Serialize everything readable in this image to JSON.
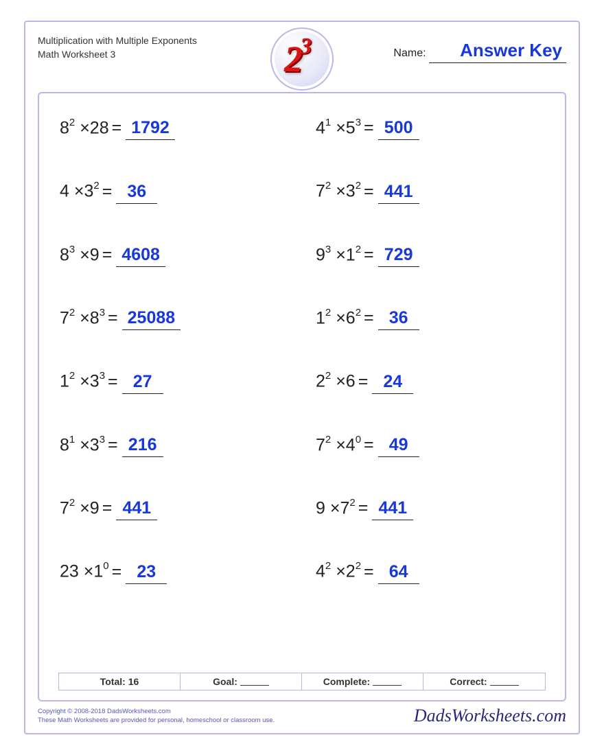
{
  "header": {
    "title_line1": "Multiplication with Multiple Exponents",
    "title_line2": "Math Worksheet 3",
    "name_label": "Name:",
    "name_value": "Answer Key",
    "logo_base": "2",
    "logo_exp": "3"
  },
  "problems": [
    {
      "b1": "8",
      "e1": "2",
      "op": "×",
      "b2": "28",
      "e2": "",
      "answer": "1792"
    },
    {
      "b1": "4",
      "e1": "1",
      "op": "×",
      "b2": "5",
      "e2": "3",
      "answer": "500"
    },
    {
      "b1": "4",
      "e1": "",
      "op": "×",
      "b2": "3",
      "e2": "2",
      "answer": "36"
    },
    {
      "b1": "7",
      "e1": "2",
      "op": "×",
      "b2": "3",
      "e2": "2",
      "answer": "441"
    },
    {
      "b1": "8",
      "e1": "3",
      "op": "×",
      "b2": "9",
      "e2": "",
      "answer": "4608"
    },
    {
      "b1": "9",
      "e1": "3",
      "op": "×",
      "b2": "1",
      "e2": "2",
      "answer": "729"
    },
    {
      "b1": "7",
      "e1": "2",
      "op": "×",
      "b2": "8",
      "e2": "3",
      "answer": "25088"
    },
    {
      "b1": "1",
      "e1": "2",
      "op": "×",
      "b2": "6",
      "e2": "2",
      "answer": "36"
    },
    {
      "b1": "1",
      "e1": "2",
      "op": "×",
      "b2": "3",
      "e2": "3",
      "answer": "27"
    },
    {
      "b1": "2",
      "e1": "2",
      "op": "×",
      "b2": "6",
      "e2": "",
      "answer": "24"
    },
    {
      "b1": "8",
      "e1": "1",
      "op": "×",
      "b2": "3",
      "e2": "3",
      "answer": "216"
    },
    {
      "b1": "7",
      "e1": "2",
      "op": "×",
      "b2": "4",
      "e2": "0",
      "answer": "49"
    },
    {
      "b1": "7",
      "e1": "2",
      "op": "×",
      "b2": "9",
      "e2": "",
      "answer": "441"
    },
    {
      "b1": "9",
      "e1": "",
      "op": "×",
      "b2": "7",
      "e2": "2",
      "answer": "441"
    },
    {
      "b1": "23",
      "e1": "",
      "op": "×",
      "b2": "1",
      "e2": "0",
      "answer": "23"
    },
    {
      "b1": "4",
      "e1": "2",
      "op": "×",
      "b2": "2",
      "e2": "2",
      "answer": "64"
    }
  ],
  "scores": {
    "total_label": "Total: 16",
    "goal_label": "Goal:",
    "complete_label": "Complete:",
    "correct_label": "Correct:"
  },
  "footer": {
    "copyright": "Copyright © 2008-2018 DadsWorksheets.com",
    "disclaimer": "These Math Worksheets are provided for personal, homeschool or classroom use.",
    "brand": "DadsWorksheets.com"
  }
}
